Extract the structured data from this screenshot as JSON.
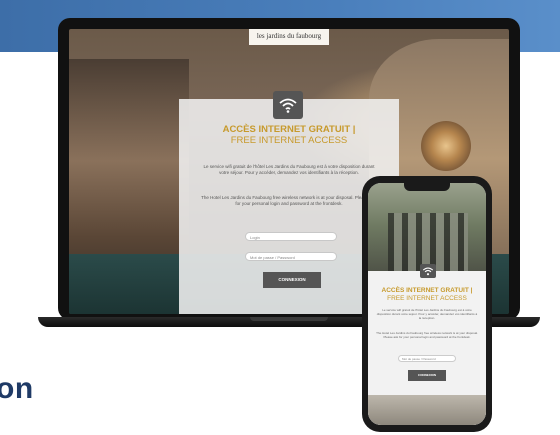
{
  "bottom_text": "on",
  "laptop": {
    "logo_text": "les jardins du faubourg",
    "title_fr": "ACCÈS INTERNET GRATUIT |",
    "title_en": "FREE INTERNET ACCESS",
    "paragraph_fr": "Le service wifi gratuit de l'hôtel Les Jardins du Faubourg est à votre disposition durant votre séjour. Pour y accéder, demandez vos identifiants à la réception.",
    "paragraph_en": "The Hotel Les Jardins du Faubourg free wireless network is at your disposal. Please ask for your personal login and password at the frontdesk.",
    "login_placeholder": "Login",
    "password_placeholder": "Mot de passe / Password",
    "connect_label": "CONNEXION"
  },
  "phone": {
    "title_fr": "ACCÈS INTERNET GRATUIT |",
    "title_en": "FREE INTERNET ACCESS",
    "paragraph_fr": "Le service wifi gratuit de l'hôtel Les Jardins du Faubourg est à votre disposition durant votre séjour. Pour y accéder, demandez vos identifiants à la réception.",
    "paragraph_en": "The Hotel Les Jardins du Faubourg free wireless network is at your disposal. Please ask for your personal login and password at the frontdesk.",
    "password_placeholder": "Mot de passe / Password",
    "connect_label": "CONNEXION"
  },
  "icons": {
    "wifi": "wifi-icon"
  },
  "colors": {
    "banner": "#4a7fbc",
    "title_gold": "#c79a2c",
    "button_gray": "#555555",
    "bottom_text": "#1f3a66"
  }
}
